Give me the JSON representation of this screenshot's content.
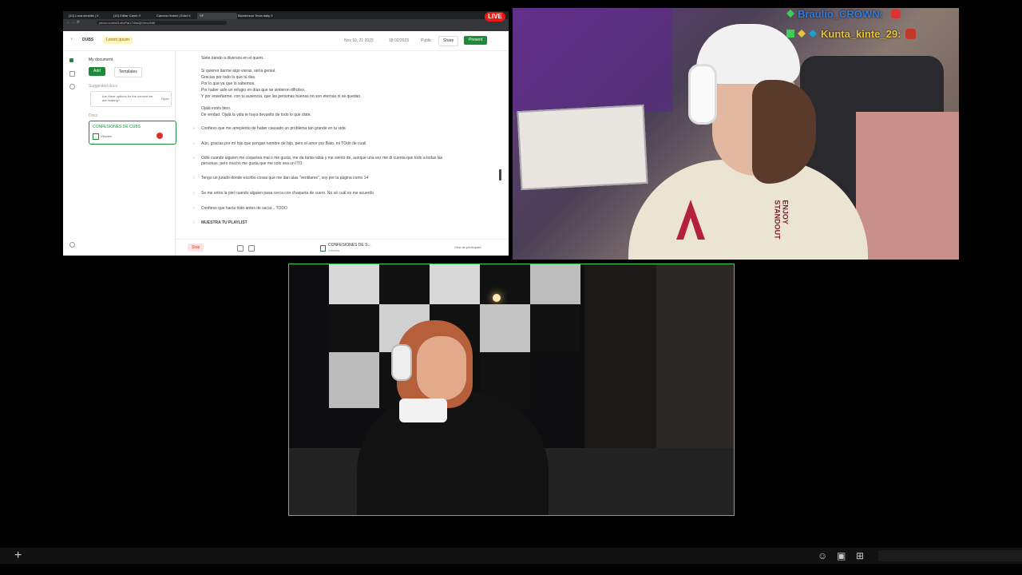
{
  "browser": {
    "tabs": [
      "(10) Luna sencilla | X",
      "(10) Editar Camb X",
      "Camera Hostel | Edict X",
      "SF",
      "Blanderson Tecla daily X"
    ],
    "url": "ydocs.com/d/1ohvPaLt7r5w2jhVmv/edit",
    "header": {
      "back": "‹",
      "title": "DUBS",
      "badge": "Lorem ipsum",
      "date": "Nov 10, 21 2023",
      "saved": "18:02/2023",
      "visibility": "Public",
      "share_label": "Share",
      "present_label": "Present"
    },
    "sidebar": {
      "heading": "My document",
      "add_label": "Add",
      "templates_label": "Templates",
      "section1": "Suggested docs",
      "suggestion": "Are there options for the content we are making?",
      "suggestion_action": "Open",
      "section2": "Docs",
      "card_title": "CONFESIONES DE CUBS",
      "card_sub": "Viewers"
    },
    "doc_lines": [
      "Siete dando a diversos en el quem.",
      "Si quieres darme algo vieras, sería genial.",
      "Gracias por todo lo que tú das.",
      "Por lo que ya que lo sabemos.",
      "Por haber sido un refugio en días que se sintieron difíciles.",
      "Y por enseñarme, con tu ausencia, que las personas buenas no son eternas ni se quedan.",
      "Ojalá estés bien.",
      "De verdad. Ojalá la vida te haya devuelto de todo lo que diste.",
      "Confieso que me arrepiento de haber causado un problema tan grande en tu vida",
      "Aún, gracias por mí hijo que pongan nombre de hijo, pero el amor por Bato, mi TOdo de cuali",
      "Odio cuando alguien me coquetea mal o me gusta, me da tanta rabia y me siento de, aunque una vez me di cuenta que todo a todas las",
      "personas, pero mucho me gusta que me solo sea un ITO.",
      "Tengo un jurado donde escribo cosas que me dan alas \"ventilares\", soy por la página como 14",
      "Se me entra la piel cuando alguien pasa cerca con chaqueta de cuero. No sé cuál es me acuerdo",
      "Confieso que hacía todo antes de sacar... TODO",
      "MUESTRA TU PLAYLIST"
    ],
    "footer": {
      "stop_label": "Stop",
      "card_title": "CONFESIONES DE S...",
      "card_sub": "Viewers",
      "link": "View as participant"
    }
  },
  "live_badge": "LIVE",
  "chat": [
    {
      "user": "Braulio_CROWN:",
      "color": "#2f7de1"
    },
    {
      "user": "Kunta_kinte_29:",
      "color": "#e8c23a"
    }
  ],
  "bottom_bar": {
    "add_icon": "plus-icon",
    "icons": [
      "emoji-icon",
      "image-icon",
      "gift-icon"
    ]
  }
}
